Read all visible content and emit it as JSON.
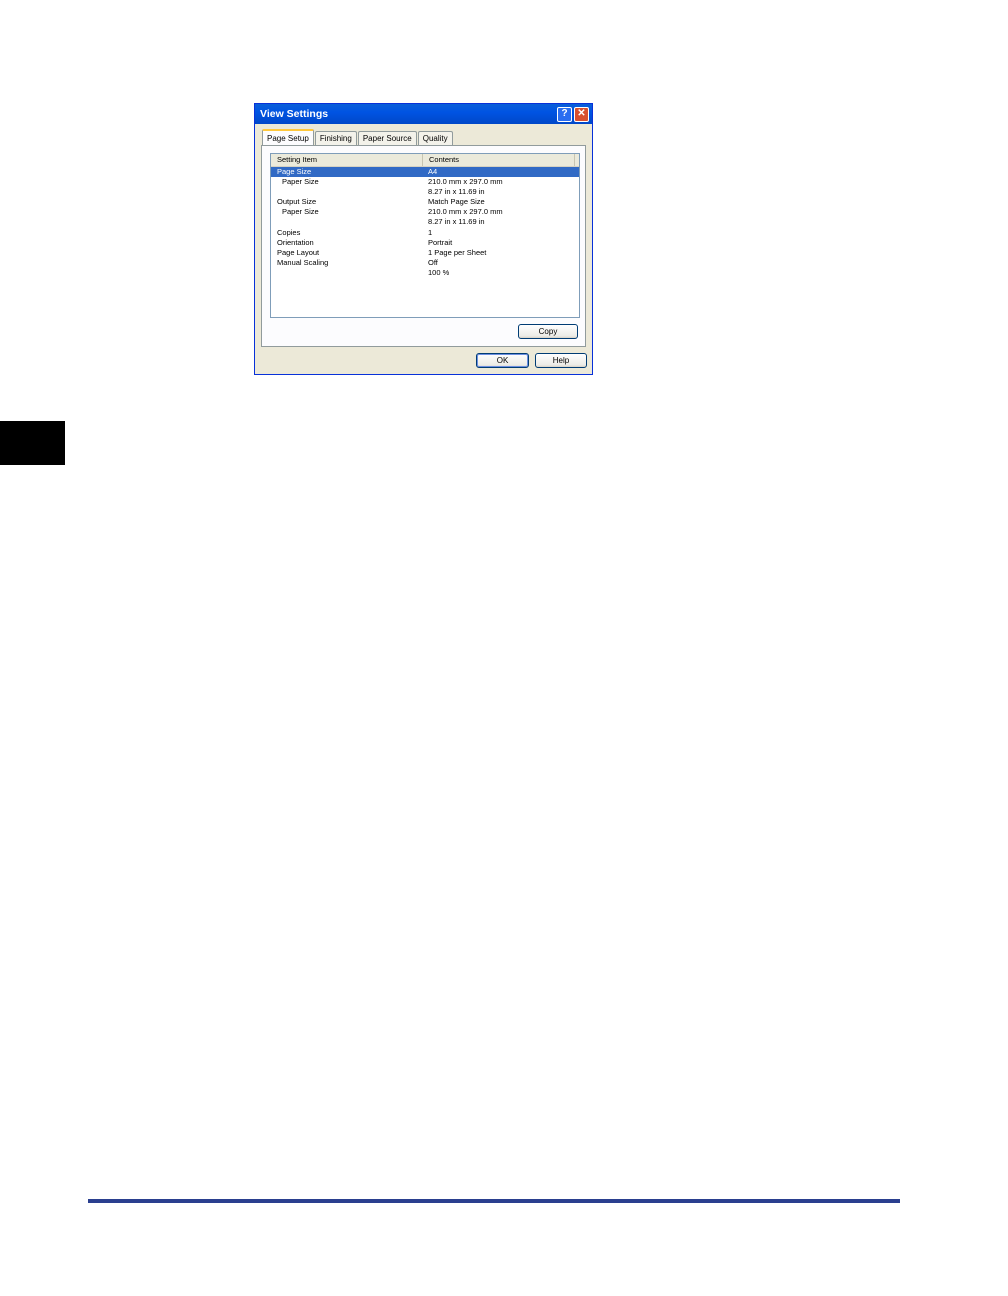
{
  "dialog": {
    "title": "View Settings",
    "help_glyph": "?",
    "close_glyph": "✕",
    "tabs": [
      {
        "label": "Page Setup",
        "active": true
      },
      {
        "label": "Finishing",
        "active": false
      },
      {
        "label": "Paper Source",
        "active": false
      },
      {
        "label": "Quality",
        "active": false
      }
    ],
    "list": {
      "headers": [
        "Setting Item",
        "Contents"
      ],
      "rows": [
        {
          "item": "Page Size",
          "content": "A4",
          "selected": true
        },
        {
          "item": "Paper Size",
          "content": "210.0 mm x 297.0 mm"
        },
        {
          "item": "",
          "content": "8.27 in x 11.69 in"
        },
        {
          "item": "Output Size",
          "content": "Match Page Size"
        },
        {
          "item": "Paper Size",
          "content": "210.0 mm x 297.0 mm"
        },
        {
          "item": "",
          "content": "8.27 in x 11.69 in"
        },
        {
          "item": "Copies",
          "content": "1"
        },
        {
          "item": "Orientation",
          "content": "Portrait"
        },
        {
          "item": "Page Layout",
          "content": "1 Page per Sheet"
        },
        {
          "item": "Manual Scaling",
          "content": "Off"
        },
        {
          "item": "",
          "content": "100 %"
        }
      ]
    },
    "buttons": {
      "copy": "Copy",
      "ok": "OK",
      "help": "Help"
    }
  },
  "colors": {
    "selection": "#316ac5",
    "titlebar": "#0054e3",
    "footer_rule": "#2a3f8f"
  }
}
